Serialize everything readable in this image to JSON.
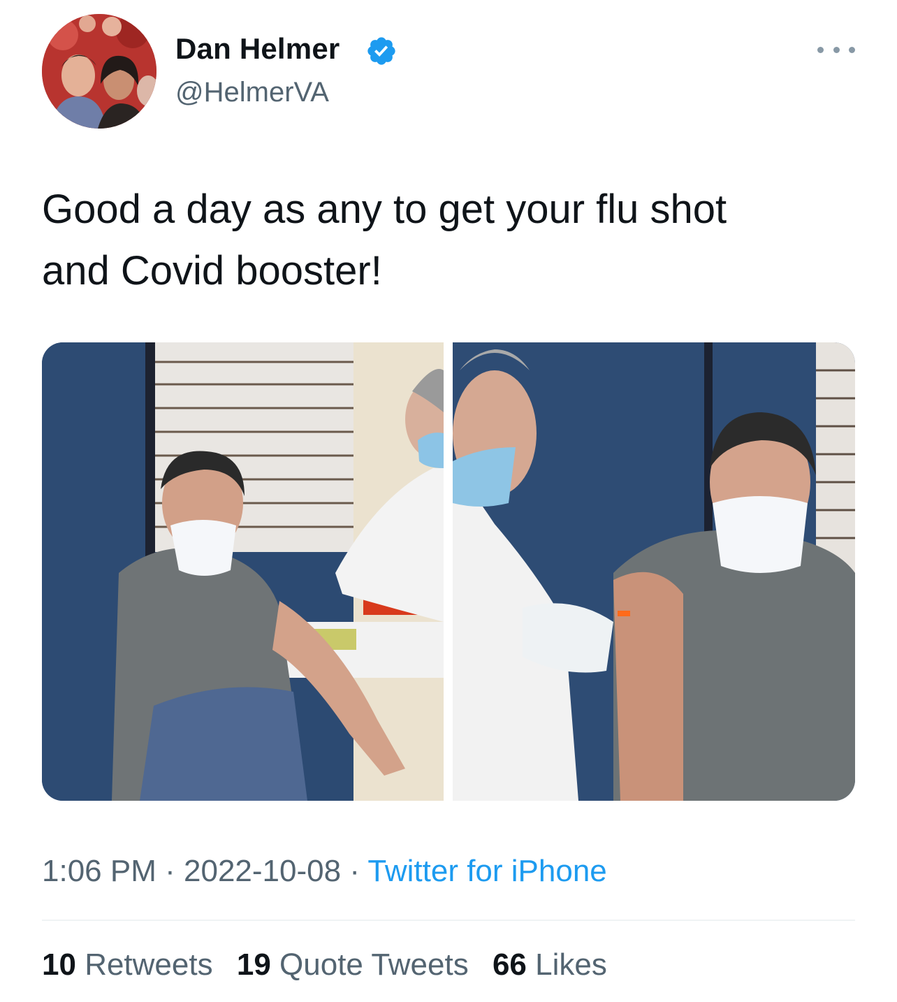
{
  "tweet": {
    "author": {
      "display_name": "Dan Helmer",
      "handle": "@HelmerVA",
      "verified": true,
      "verified_color": "#1d9bf0"
    },
    "more_icon": "more-horizontal-icon",
    "text_line1": "Good a day as any to get your flu shot",
    "text_line2": "and Covid booster!",
    "time": "1:06 PM",
    "separator": "·",
    "date": "2022-10-08",
    "source": "Twitter for iPhone",
    "stats": {
      "retweets_count": "10",
      "retweets_label": "Retweets",
      "quotes_count": "19",
      "quotes_label": "Quote Tweets",
      "likes_count": "66",
      "likes_label": "Likes"
    }
  },
  "colors": {
    "text": "#0f1419",
    "secondary": "#536471",
    "link": "#1d9bf0",
    "divider": "#eff3f4"
  }
}
